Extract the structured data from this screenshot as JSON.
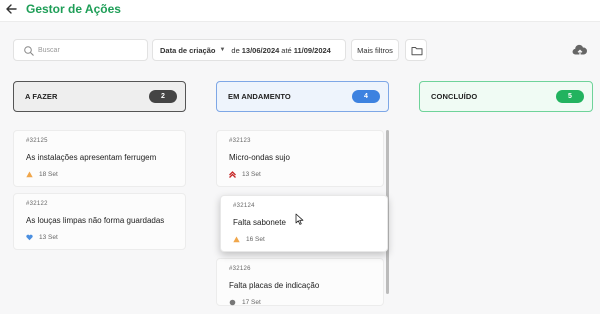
{
  "app": {
    "title": "Gestor de Ações"
  },
  "toolbar": {
    "search_placeholder": "Buscar",
    "date_field": "Data de criação",
    "date_from_word": "de",
    "date_from": "13/06/2024",
    "date_to_word": "até",
    "date_to": "11/09/2024",
    "more_filters": "Mais filtros"
  },
  "columns": [
    {
      "label": "A FAZER",
      "count": "2"
    },
    {
      "label": "EM ANDAMENTO",
      "count": "4"
    },
    {
      "label": "CONCLUÍDO",
      "count": "5"
    }
  ],
  "cards": {
    "todo": [
      {
        "id": "#32125",
        "title": "As instalações apresentam ferrugem",
        "date": "18 Set",
        "priority_icon": "triangle-warning-icon"
      },
      {
        "id": "#32122",
        "title": "As louças limpas não forma guardadas",
        "date": "13 Set",
        "priority_icon": "heart-low-icon"
      }
    ],
    "progress": [
      {
        "id": "#32123",
        "title": "Micro-ondas sujo",
        "date": "13 Set",
        "priority_icon": "double-chevron-up-icon"
      },
      {
        "id": "#32124",
        "title": "Falta sabonete",
        "date": "16 Set",
        "priority_icon": "triangle-warning-icon"
      },
      {
        "id": "#32126",
        "title": "Falta placas de indicação",
        "date": "17 Set",
        "priority_icon": "dot-icon"
      }
    ]
  },
  "colors": {
    "brand": "#1e9e57",
    "todo_accent": "#444444",
    "progress_accent": "#3d82e0",
    "done_accent": "#22b35f"
  }
}
